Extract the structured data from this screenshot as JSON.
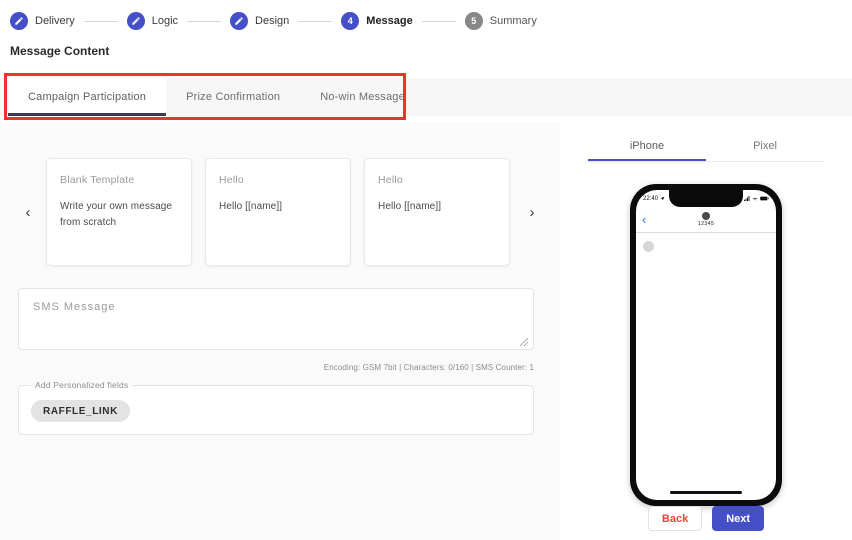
{
  "stepper": {
    "steps": [
      {
        "label": "Delivery",
        "number": "1",
        "state": "done"
      },
      {
        "label": "Logic",
        "number": "2",
        "state": "done"
      },
      {
        "label": "Design",
        "number": "3",
        "state": "done"
      },
      {
        "label": "Message",
        "number": "4",
        "state": "active"
      },
      {
        "label": "Summary",
        "number": "5",
        "state": "idle"
      }
    ]
  },
  "page": {
    "title": "Message Content"
  },
  "tabs": {
    "items": [
      {
        "label": "Campaign Participation",
        "active": true
      },
      {
        "label": "Prize Confirmation",
        "active": false
      },
      {
        "label": "No-win Message",
        "active": false
      }
    ],
    "annotation_color": "#f0312c"
  },
  "carousel": {
    "prev_label": "‹",
    "next_label": "›",
    "templates": [
      {
        "title": "Blank Template",
        "body": "Write your own message from scratch"
      },
      {
        "title": "Hello",
        "body": "Hello [[name]]"
      },
      {
        "title": "Hello",
        "body": "Hello [[name]]"
      }
    ]
  },
  "sms": {
    "placeholder": "SMS Message",
    "value": "",
    "meta": "Encoding: GSM 7bit | Characters: 0/160 | SMS Counter: 1"
  },
  "personalized": {
    "legend": "Add Personalized fields",
    "chips": [
      "RAFFLE_LINK"
    ]
  },
  "preview": {
    "tabs": [
      {
        "label": "iPhone",
        "active": true
      },
      {
        "label": "Pixel",
        "active": false
      }
    ],
    "phone": {
      "time": "22:40",
      "contact": "12345"
    }
  },
  "footer": {
    "back_label": "Back",
    "next_label": "Next",
    "back_color": "#f04438",
    "next_color": "#4550c8"
  }
}
